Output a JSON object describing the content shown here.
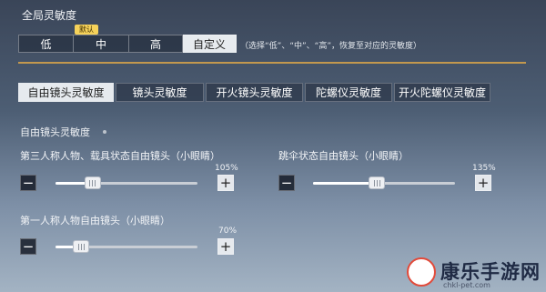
{
  "global_sensitivity": {
    "title": "全局灵敏度",
    "default_badge": "默认",
    "levels": [
      "低",
      "中",
      "高",
      "自定义"
    ],
    "selected": "自定义",
    "hint": "（选择“低”、“中”、“高”，恢复至对应的灵敏度）"
  },
  "tabs": [
    {
      "label": "自由镜头灵敏度",
      "active": true
    },
    {
      "label": "镜头灵敏度",
      "active": false
    },
    {
      "label": "开火镜头灵敏度",
      "active": false
    },
    {
      "label": "陀螺仪灵敏度",
      "active": false
    },
    {
      "label": "开火陀螺仪灵敏度",
      "active": false
    }
  ],
  "section": {
    "title": "自由镜头灵敏度",
    "sliders": [
      {
        "label": "第三人称人物、载具状态自由镜头（小眼睛）",
        "value": "105%",
        "level": 0.26
      },
      {
        "label": "跳伞状态自由镜头（小眼睛）",
        "value": "135%",
        "level": 0.45
      },
      {
        "label": "第一人称人物自由镜头（小眼睛）",
        "value": "70%",
        "level": 0.18
      }
    ],
    "minus_symbol": "−",
    "plus_symbol": "+"
  },
  "watermark": {
    "text": "康乐手游网",
    "url": "chkl-pet.com"
  },
  "colors": {
    "accent_divider": "#d9a54a",
    "active_tab_bg": "#e6eaee",
    "badge": "#f6d25a"
  }
}
